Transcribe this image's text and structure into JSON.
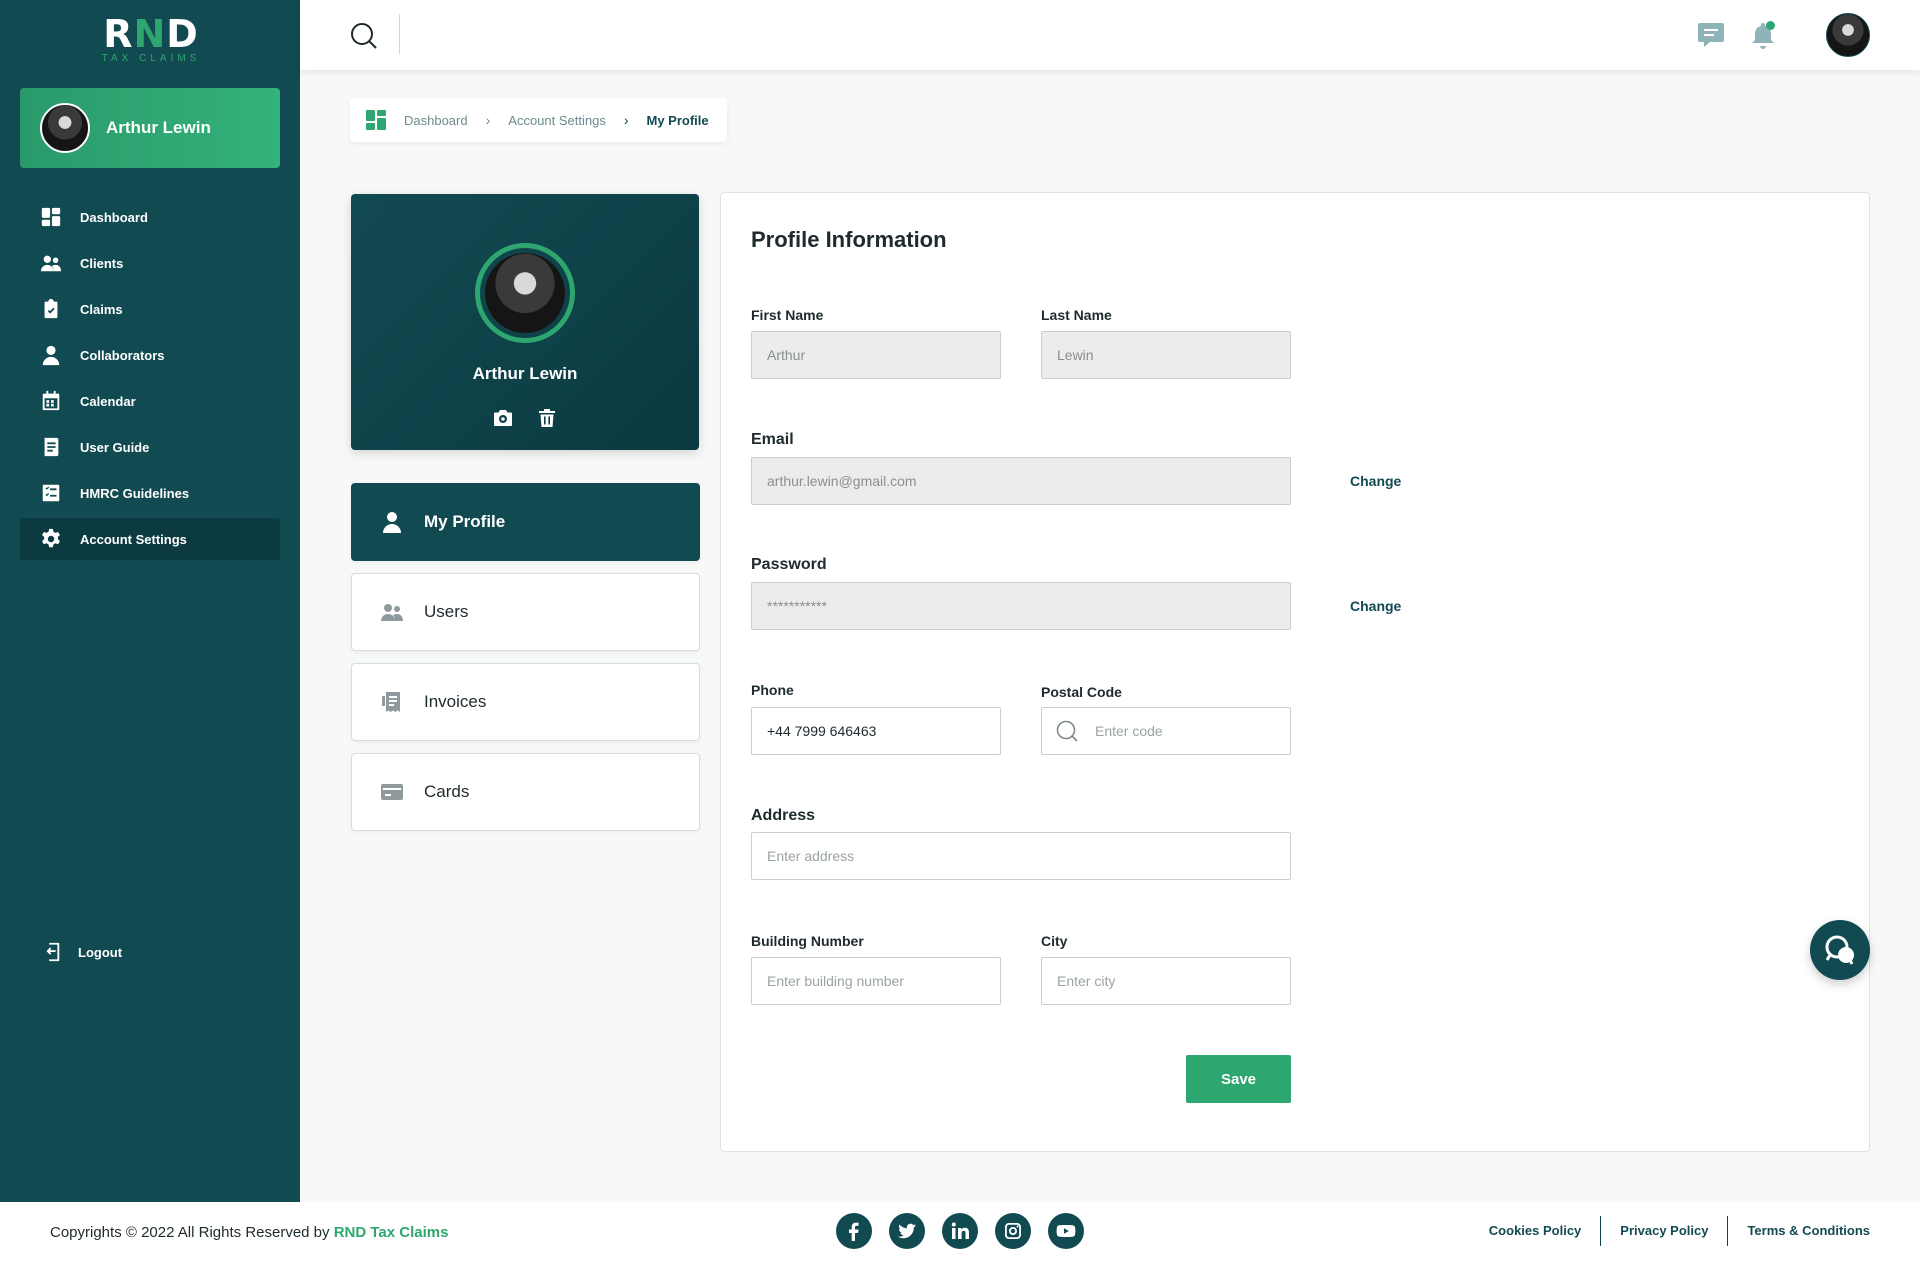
{
  "brand": {
    "logo_mark_left": "R",
    "logo_mark_mid": "N",
    "logo_mark_right": "D",
    "logo_subtitle": "TAX CLAIMS",
    "accent_color": "#2ea66f",
    "primary_color": "#124a52"
  },
  "sidebar": {
    "user_name": "Arthur Lewin",
    "items": [
      {
        "label": "Dashboard",
        "icon": "dashboard-icon"
      },
      {
        "label": "Clients",
        "icon": "users-icon"
      },
      {
        "label": "Claims",
        "icon": "clipboard-check-icon"
      },
      {
        "label": "Collaborators",
        "icon": "person-icon"
      },
      {
        "label": "Calendar",
        "icon": "calendar-icon"
      },
      {
        "label": "User Guide",
        "icon": "book-icon"
      },
      {
        "label": "HMRC Guidelines",
        "icon": "checklist-icon"
      },
      {
        "label": "Account Settings",
        "icon": "gear-icon",
        "active": true
      }
    ],
    "logout_label": "Logout"
  },
  "header": {
    "icons": [
      "search-icon",
      "chat-icon",
      "bell-icon",
      "avatar"
    ]
  },
  "breadcrumb": {
    "items": [
      "Dashboard",
      "Account Settings"
    ],
    "current": "My Profile"
  },
  "profile_card": {
    "name": "Arthur Lewin",
    "actions": [
      "camera-icon",
      "trash-icon"
    ]
  },
  "settings_menu": {
    "items": [
      {
        "label": "My Profile",
        "icon": "person-icon",
        "active": true
      },
      {
        "label": "Users",
        "icon": "users-icon"
      },
      {
        "label": "Invoices",
        "icon": "receipt-icon"
      },
      {
        "label": "Cards",
        "icon": "card-icon"
      }
    ]
  },
  "form": {
    "title": "Profile Information",
    "first_name": {
      "label": "First Name",
      "value": "Arthur"
    },
    "last_name": {
      "label": "Last Name",
      "value": "Lewin"
    },
    "email": {
      "label": "Email",
      "value": "arthur.lewin@gmail.com",
      "action": "Change"
    },
    "password": {
      "label": "Password",
      "value": "***********",
      "action": "Change"
    },
    "phone": {
      "label": "Phone",
      "value": "+44 7999 646463"
    },
    "postal_code": {
      "label": "Postal Code",
      "placeholder": "Enter code"
    },
    "address": {
      "label": "Address",
      "placeholder": "Enter address"
    },
    "building_number": {
      "label": "Building Number",
      "placeholder": "Enter building number"
    },
    "city": {
      "label": "City",
      "placeholder": "Enter city"
    },
    "save_label": "Save"
  },
  "footer": {
    "copyright_prefix": "Copyrights © 2022 All Rights Reserved by ",
    "copyright_brand": "RND Tax Claims",
    "socials": [
      "facebook-icon",
      "twitter-icon",
      "linkedin-icon",
      "instagram-icon",
      "youtube-icon"
    ],
    "links": [
      "Cookies Policy",
      "Privacy Policy",
      "Terms & Conditions"
    ]
  }
}
